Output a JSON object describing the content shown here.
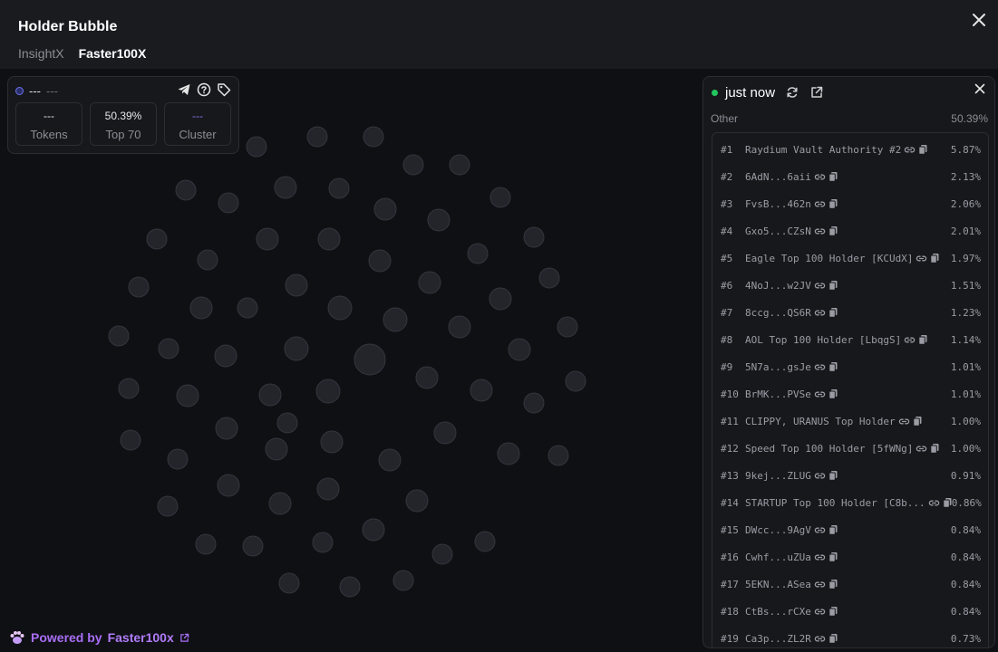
{
  "header": {
    "title": "Holder Bubble",
    "tabs": [
      {
        "label": "InsightX",
        "active": false
      },
      {
        "label": "Faster100X",
        "active": true
      }
    ],
    "close_icon": "close-icon"
  },
  "stats_card": {
    "name": "---",
    "sub": "---",
    "icons": [
      "telegram-icon",
      "help-icon",
      "tag-icon"
    ],
    "boxes": [
      {
        "value": "---",
        "label": "Tokens"
      },
      {
        "value": "50.39%",
        "label": "Top 70"
      },
      {
        "value": "---",
        "label": "Cluster"
      }
    ]
  },
  "panel": {
    "status_time": "just now",
    "other_label": "Other",
    "other_value": "50.39%",
    "holders": [
      {
        "rank": "#1",
        "name": "Raydium Vault Authority #2",
        "pct": "5.87%"
      },
      {
        "rank": "#2",
        "name": "6AdN...6aii",
        "pct": "2.13%"
      },
      {
        "rank": "#3",
        "name": "FvsB...462n",
        "pct": "2.06%"
      },
      {
        "rank": "#4",
        "name": "Gxo5...CZsN",
        "pct": "2.01%"
      },
      {
        "rank": "#5",
        "name": "Eagle Top 100 Holder [KCUdX]",
        "pct": "1.97%"
      },
      {
        "rank": "#6",
        "name": "4NoJ...w2JV",
        "pct": "1.51%"
      },
      {
        "rank": "#7",
        "name": "8ccg...QS6R",
        "pct": "1.23%"
      },
      {
        "rank": "#8",
        "name": "AOL Top 100 Holder [LbqgS]",
        "pct": "1.14%"
      },
      {
        "rank": "#9",
        "name": "5N7a...gsJe",
        "pct": "1.01%"
      },
      {
        "rank": "#10",
        "name": "BrMK...PVSe",
        "pct": "1.01%"
      },
      {
        "rank": "#11",
        "name": "CLIPPY, URANUS Top Holder",
        "pct": "1.00%"
      },
      {
        "rank": "#12",
        "name": "Speed Top 100 Holder [5fWNg]",
        "pct": "1.00%"
      },
      {
        "rank": "#13",
        "name": "9kej...ZLUG",
        "pct": "0.91%"
      },
      {
        "rank": "#14",
        "name": "STARTUP Top 100 Holder [C8b...",
        "pct": "0.86%"
      },
      {
        "rank": "#15",
        "name": "DWcc...9AgV",
        "pct": "0.84%"
      },
      {
        "rank": "#16",
        "name": "Cwhf...uZUa",
        "pct": "0.84%"
      },
      {
        "rank": "#17",
        "name": "5EKN...ASea",
        "pct": "0.84%"
      },
      {
        "rank": "#18",
        "name": "CtBs...rCXe",
        "pct": "0.84%"
      },
      {
        "rank": "#19",
        "name": "Ca3p...ZL2R",
        "pct": "0.73%"
      }
    ]
  },
  "footer": {
    "powered_prefix": "Powered by",
    "powered_brand": "Faster100x"
  },
  "colors": {
    "bubble_fill": "#23252b",
    "bubble_stroke": "#33363d",
    "accent_purple": "#a86ef5",
    "status_green": "#22c55e"
  }
}
